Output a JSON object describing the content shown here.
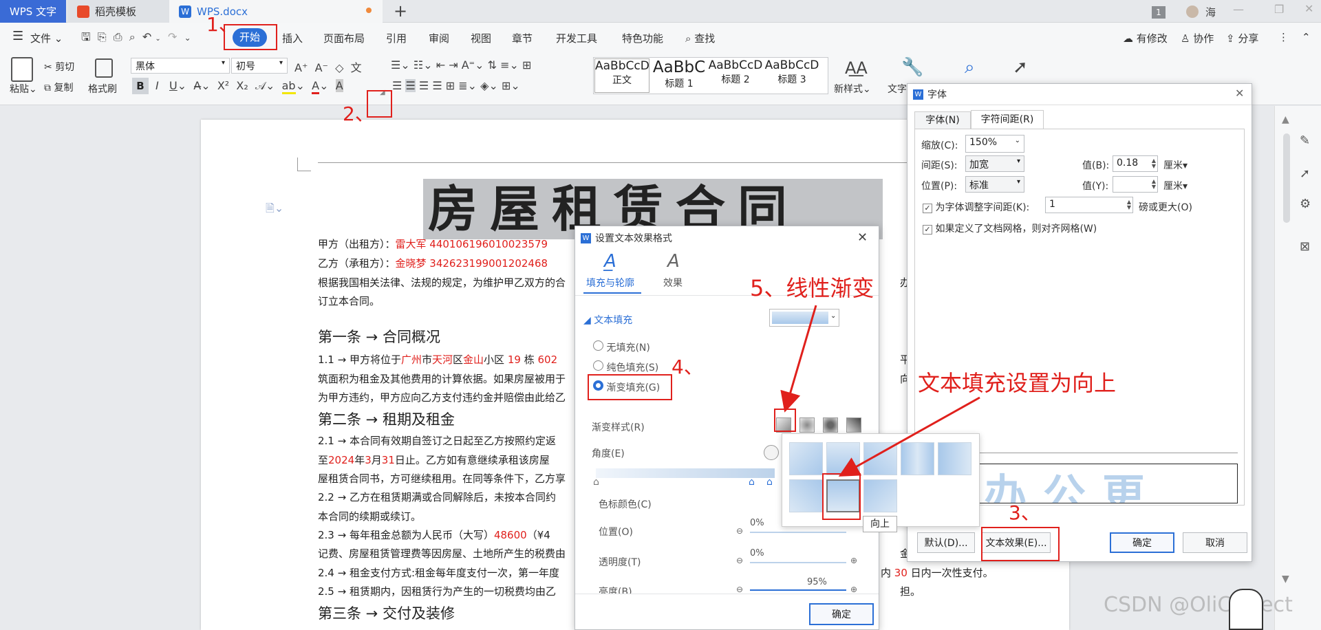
{
  "titlebar": {
    "app_tab": "WPS 文字",
    "template_tab": "稻壳模板",
    "doc_tab": "WPS.docx",
    "new_tab": "+",
    "badge": "1",
    "user": "海"
  },
  "menu": {
    "file": "文件",
    "items": [
      "开始",
      "插入",
      "页面布局",
      "引用",
      "审阅",
      "视图",
      "章节",
      "开发工具",
      "特色功能"
    ],
    "search": "查找",
    "right": [
      "有修改",
      "协作",
      "分享"
    ]
  },
  "ribbon": {
    "paste": "粘贴",
    "cut": "剪切",
    "copy": "复制",
    "format_painter": "格式刷",
    "font_name": "黑体",
    "font_size": "初号",
    "styles": [
      {
        "preview": "AaBbCcD",
        "label": "正文"
      },
      {
        "preview": "AaBbC",
        "label": "标题 1"
      },
      {
        "preview": "AaBbCcD",
        "label": "标题 2"
      },
      {
        "preview": "AaBbCcD",
        "label": "标题 3"
      }
    ],
    "new_style": "新样式",
    "text_tool": "文字"
  },
  "document": {
    "title": "房屋租赁合同",
    "line1_label": "甲方（出租方）：",
    "line1_value": "雷大军 440106196010023579",
    "line2_label": "乙方（承租方）：",
    "line2_value": "金晓梦 342623199001202468",
    "line3a": "根据我国相关法律、法规的规定，为维护甲乙双方的合",
    "line3b": "办商，",
    "line4": "订立本合同。",
    "s1": "第一条 → 合同概况",
    "p11_pre": "1.1 → 甲方将位于",
    "p11_city": "广州",
    "p11_mid1": "市",
    "p11_dist": "天河",
    "p11_mid2": "区",
    "p11_comm": "金山",
    "p11_mid3": "小区",
    "p11_bld": "19",
    "p11_mid4": "栋",
    "p11_rm": "602",
    "p11_end": "平面图",
    "p12": "筑面积为租金及其他费用的计算依据。如果房屋被用于",
    "p12_end": "向乙方",
    "p13": "为甲方违约，甲方应向乙方支付违约金并赔偿由此给乙",
    "s2": "第二条 → 租期及租金",
    "p21": "2.1 → 本合同有效期自签订之日起至乙方按照约定返",
    "p22_pre": "至",
    "p22_y": "2024",
    "p22_m1": "年",
    "p22_mm": "3",
    "p22_m2": "月",
    "p22_d": "31",
    "p22_end": "日止。乙方如有意继续承租该房屋",
    "p23": "屋租赁合同书，方可继续租用。在同等条件下，乙方享",
    "p24": "2.2 → 乙方在租赁期满或合同解除后，未按本合同约",
    "p25": "本合同的续期或续订。",
    "p26_pre": "2.3 → 每年租金总额为人民币（大写）",
    "p26_amt": "48600",
    "p26_end": "（¥4",
    "p27": "记费、房屋租赁管理费等因房屋、土地所产生的税费由",
    "p27_end": "金数",
    "p28": "2.4 → 租金支付方式:租金每年度支付一次，第一年度",
    "p28_mid": "内",
    "p28_num": "30",
    "p28_end": "日内一次性支付。",
    "p29": "2.5 → 租赁期内，因租赁行为产生的一切税费均由乙",
    "p29_end": "担。",
    "s3": "第三条 → 交付及装修"
  },
  "effects_dialog": {
    "title": "设置文本效果格式",
    "tab_fill": "填充与轮廓",
    "tab_effect": "效果",
    "section": "文本填充",
    "opt_none": "无填充(N)",
    "opt_solid": "纯色填充(S)",
    "opt_gradient": "渐变填充(G)",
    "gradient_style": "渐变样式(R)",
    "angle": "角度(E)",
    "stop_color": "色标颜色(C)",
    "position": "位置(O)",
    "position_val": "0%",
    "transparency": "透明度(T)",
    "transparency_val": "0%",
    "brightness": "亮度(B)",
    "brightness_val": "95%",
    "ok": "确定",
    "tooltip": "向上"
  },
  "font_dialog": {
    "title": "字体",
    "tab_font": "字体(N)",
    "tab_spacing": "字符间距(R)",
    "scale_label": "缩放(C):",
    "scale_val": "150%",
    "spacing_label": "间距(S):",
    "spacing_val": "加宽",
    "spacing_by_label": "值(B):",
    "spacing_by_val": "0.18",
    "unit1": "厘米",
    "position_label": "位置(P):",
    "position_val": "标准",
    "position_by_label": "值(Y):",
    "position_by_val": "",
    "unit2": "厘米",
    "kerning_label": "为字体调整字间距(K):",
    "kerning_val": "1",
    "kerning_suffix": "磅或更大(O)",
    "grid_label": "如果定义了文档网格，则对齐网格(W)",
    "preview_text": "办公更",
    "default_btn": "默认(D)...",
    "effects_btn": "文本效果(E)...",
    "ok": "确定",
    "cancel": "取消"
  },
  "annotations": {
    "a1": "1、",
    "a2": "2、",
    "a3": "3、",
    "a4": "4、",
    "a5": "5、线性渐变",
    "a6": "文本填充设置为向上"
  },
  "watermark": "CSDN @OliCorrect",
  "colors": {
    "accent": "#2b6fd6",
    "annotation": "#e0201c",
    "ribbon_bg": "#f6f7f8"
  }
}
